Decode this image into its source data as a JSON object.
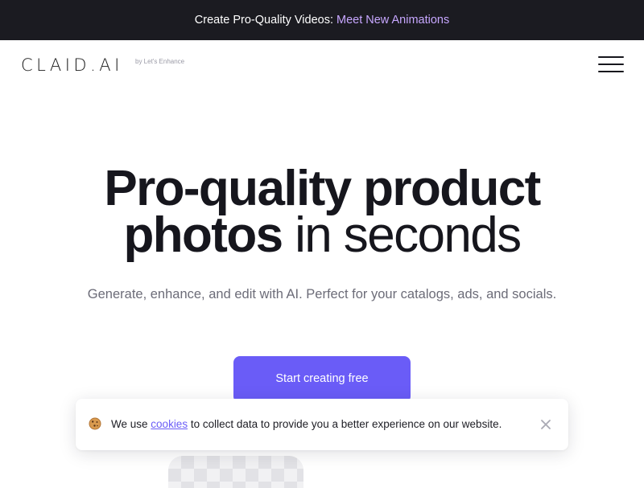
{
  "announcement": {
    "text": "Create Pro-Quality Videos:",
    "link_text": "Meet New Animations"
  },
  "header": {
    "logo_text": "CLAID.AI",
    "logo_tagline": "by Let's Enhance",
    "menu_icon": "hamburger-menu-icon"
  },
  "hero": {
    "title_bold_1": "Pro-quality product",
    "title_bold_2": "photos",
    "title_light": "in seconds",
    "subtitle": "Generate, enhance, and edit with AI. Perfect for your catalogs, ads, and socials.",
    "cta_label": "Start creating free"
  },
  "cookie_banner": {
    "icon": "cookie-icon",
    "text_before": "We use",
    "link_text": "cookies",
    "text_after": "to collect data to provide you a better experience on our website.",
    "close_icon": "close-icon"
  },
  "colors": {
    "accent": "#6a5cf7",
    "announce_bg": "#1b1b21",
    "announce_link": "#c7a7ff",
    "text_dark": "#16161d",
    "text_muted": "#6c6c78"
  }
}
